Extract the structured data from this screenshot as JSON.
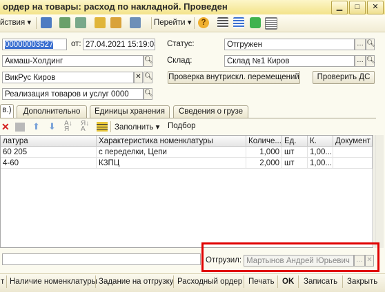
{
  "window": {
    "title": "ордер на товары: расход по накладной. Проведен"
  },
  "toolbar": {
    "actions_label": "йствия",
    "goto_label": "Перейти"
  },
  "header": {
    "number": "00000003527",
    "date_label": "от:",
    "date": "27.04.2021 15:19:08",
    "organization": "Акмаш-Холдинг",
    "contractor": "ВикРус Киров",
    "basis": "Реализация товаров и услуг 0000",
    "status_label": "Статус:",
    "status": "Отгружен",
    "warehouse_label": "Склад:",
    "warehouse": "Склад №1 Киров",
    "check_transfers_button": "Проверка внутрискл. перемещений",
    "check_ds_button": "Проверить ДС"
  },
  "tabs": [
    {
      "label": "в.)"
    },
    {
      "label": "Дополнительно"
    },
    {
      "label": "Единицы хранения"
    },
    {
      "label": "Сведения о грузе"
    }
  ],
  "table_toolbar": {
    "fill_label": "Заполнить",
    "select_label": "Подбор"
  },
  "table": {
    "columns": [
      "латура",
      "Характеристика номенклатуры",
      "Количе...",
      "Ед.",
      "К.",
      "Документ"
    ],
    "rows": [
      {
        "item": "60 205",
        "characteristic": "с переделки, Цепи",
        "qty": "1,000",
        "unit": "шт",
        "k": "1,00..."
      },
      {
        "item": "4-60",
        "characteristic": "КЗПЦ",
        "qty": "2,000",
        "unit": "шт",
        "k": "1,00..."
      }
    ]
  },
  "footer": {
    "shipped_label": "Отгрузил:",
    "shipped_by": "Мартынов Андрей Юрьевич"
  },
  "bottom_buttons": {
    "left": "т",
    "availability": "Наличие номенклатуры",
    "task": "Задание на отгрузку",
    "expense_order": "Расходный ордер",
    "print": "Печать",
    "ok": "OK",
    "write": "Записать",
    "close": "Закрыть"
  },
  "colors": {
    "highlight_border": "#e00000",
    "selection": "#3a6fd0",
    "titlebar": "#f3e38a"
  }
}
